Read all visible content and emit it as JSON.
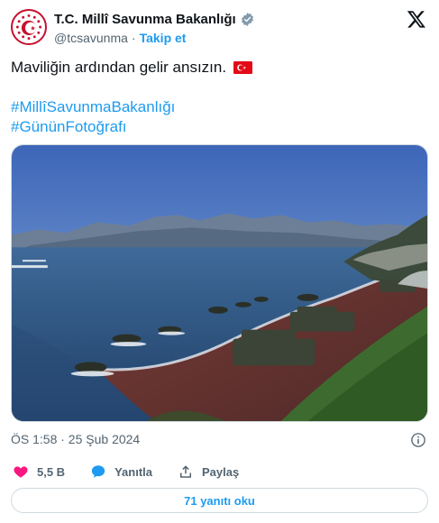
{
  "author": {
    "display_name": "T.C. Millî Savunma Bakanlığı",
    "handle": "@tcsavunma",
    "separator": "·",
    "follow_label": "Takip et",
    "verified": true
  },
  "tweet": {
    "text": "Maviliğin ardından gelir ansızın.",
    "hashtags": [
      "#MillîSavunmaBakanlığı",
      "#GününFotoğrafı"
    ]
  },
  "meta": {
    "timestamp": "ÖS 1:58 · 25 Şub 2024"
  },
  "actions": {
    "like_count": "5,5 B",
    "reply_label": "Yanıtla",
    "share_label": "Paylaş"
  },
  "replies_button": "71 yanıtı oku",
  "colors": {
    "accent": "#1d9bf0",
    "like": "#f91880",
    "text": "#0f1419",
    "muted": "#536471",
    "border": "#cfd9de",
    "flag_red": "#e30a17"
  },
  "icons": {
    "avatar": "ministry-emblem-icon",
    "verified": "verified-badge-icon",
    "brand": "x-logo-icon",
    "flag": "turkey-flag-icon",
    "info": "info-icon",
    "like": "heart-icon",
    "reply": "reply-bubble-icon",
    "share": "share-icon"
  }
}
